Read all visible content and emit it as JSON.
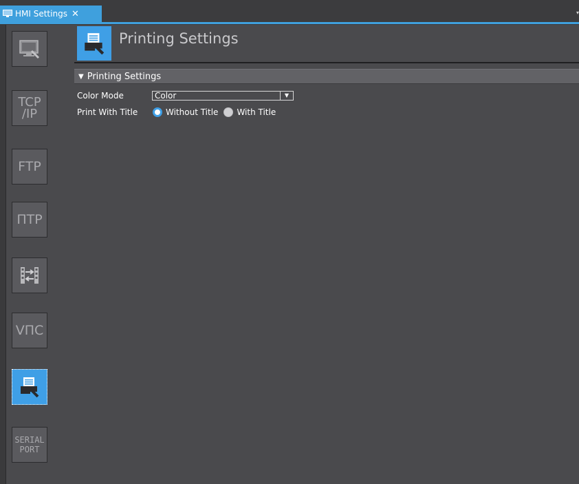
{
  "tab": {
    "label": "HMI Settings",
    "close_glyph": "✕",
    "dropdown_glyph": "▾"
  },
  "sidebar": {
    "items": [
      {
        "name": "hmi-device",
        "icon": "monitor-wrench-icon",
        "text": ""
      },
      {
        "name": "tcp-ip",
        "icon": "",
        "text": "TCP\n/IP"
      },
      {
        "name": "ftp",
        "icon": "",
        "text": "FTP"
      },
      {
        "name": "ntp",
        "icon": "",
        "text": "ПТР"
      },
      {
        "name": "transfer",
        "icon": "transfer-arrows-icon",
        "text": ""
      },
      {
        "name": "vnc",
        "icon": "",
        "text": "VПC"
      },
      {
        "name": "printing",
        "icon": "printer-wrench-icon",
        "text": "",
        "active": true
      },
      {
        "name": "serial-port",
        "icon": "",
        "text": "SERIAL\nPORT"
      }
    ]
  },
  "page": {
    "title": "Printing Settings",
    "icon": "printer-wrench-icon"
  },
  "section": {
    "label": "Printing Settings",
    "toggle_glyph": "▼"
  },
  "fields": {
    "color_mode": {
      "label": "Color Mode",
      "value": "Color"
    },
    "print_with_title": {
      "label": "Print With Title",
      "options": [
        "Without Title",
        "With Title"
      ],
      "selected": "Without Title"
    }
  },
  "colors": {
    "accent": "#3f9fe6",
    "background": "#4a4a4d",
    "sidebar_button": "#5a5a5e"
  }
}
